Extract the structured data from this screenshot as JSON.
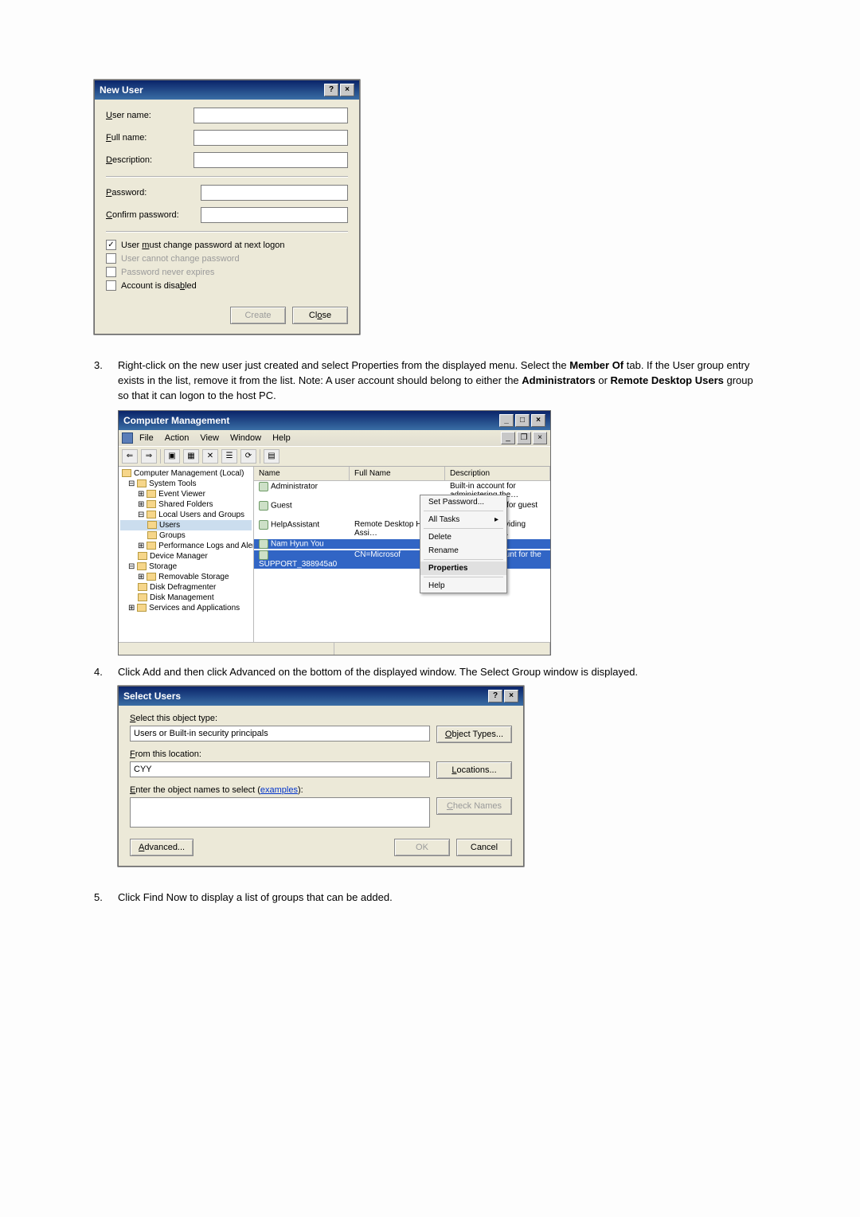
{
  "new_user": {
    "title": "New User",
    "fields": {
      "user_name": "User name:",
      "full_name": "Full name:",
      "description": "Description:",
      "password": "Password:",
      "confirm_password": "Confirm password:"
    },
    "checkboxes": {
      "must_change": "User must change password at next logon",
      "cannot_change": "User cannot change password",
      "never_expires": "Password never expires",
      "disabled": "Account is disabled"
    },
    "buttons": {
      "create": "Create",
      "close": "Close"
    }
  },
  "steps": {
    "s3_num": "3.",
    "s3_a": "Right-click on the new user just created and select Properties from the displayed menu. Select the ",
    "s3_b": "Member Of",
    "s3_c": " tab. If the User group entry exists in the list, remove it from the list. Note: A user account should belong to either the ",
    "s3_d": "Administrators",
    "s3_e": " or ",
    "s3_f": "Remote Desktop Users",
    "s3_g": " group so that it can logon to the host PC.",
    "s4_num": "4.",
    "s4": "Click Add and then click Advanced on the bottom of the displayed window. The Select Group window is displayed.",
    "s5_num": "5.",
    "s5": "Click Find Now to display a list of groups that can be added."
  },
  "mmc": {
    "title": "Computer Management",
    "menus": {
      "file": "File",
      "action": "Action",
      "view": "View",
      "window": "Window",
      "help": "Help"
    },
    "tree": {
      "root": "Computer Management (Local)",
      "system_tools": "System Tools",
      "event_viewer": "Event Viewer",
      "shared_folders": "Shared Folders",
      "local_users": "Local Users and Groups",
      "users": "Users",
      "groups": "Groups",
      "perf": "Performance Logs and Alerts",
      "devmgr": "Device Manager",
      "storage": "Storage",
      "removable": "Removable Storage",
      "defrag": "Disk Defragmenter",
      "diskmgmt": "Disk Management",
      "services": "Services and Applications"
    },
    "cols": {
      "name": "Name",
      "full": "Full Name",
      "desc": "Description"
    },
    "users": [
      {
        "name": "Administrator",
        "full": "",
        "desc": "Built-in account for administering the…"
      },
      {
        "name": "Guest",
        "full": "",
        "desc": "Built-in account for guest access to t…"
      },
      {
        "name": "HelpAssistant",
        "full": "Remote Desktop Help Assi…",
        "desc": "Account for Providing Remote Assist…"
      },
      {
        "name": "Nam Hyun You",
        "full": "",
        "desc": ""
      },
      {
        "name": "SUPPORT_388945a0",
        "full": "CN=Microsof",
        "desc": "a vendor's account for the He…"
      }
    ],
    "ctx": {
      "set_password": "Set Password...",
      "all_tasks": "All Tasks",
      "delete": "Delete",
      "rename": "Rename",
      "properties": "Properties",
      "help": "Help"
    }
  },
  "select_users": {
    "title": "Select Users",
    "object_type_label": "Select this object type:",
    "object_type_value": "Users or Built-in security principals",
    "object_types_btn": "Object Types...",
    "from_location_label": "From this location:",
    "from_location_value": "CYY",
    "locations_btn": "Locations...",
    "enter_names_label": "Enter the object names to select (",
    "examples_link": "examples",
    "enter_names_close": "):",
    "check_names": "Check Names",
    "advanced": "Advanced...",
    "ok": "OK",
    "cancel": "Cancel"
  }
}
